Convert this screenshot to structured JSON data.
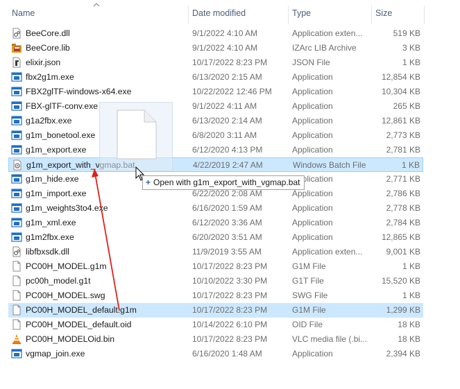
{
  "header": {
    "columns": [
      {
        "label": "Name"
      },
      {
        "label": "Date modified"
      },
      {
        "label": "Type"
      },
      {
        "label": "Size"
      }
    ]
  },
  "files": [
    {
      "name": "BeeCore.dll",
      "date": "9/1/2022 4:10 AM",
      "type": "Application exten...",
      "size": "519 KB",
      "icon": "dll-icon"
    },
    {
      "name": "BeeCore.lib",
      "date": "9/1/2022 4:10 AM",
      "type": "IZArc LIB Archive",
      "size": "3 KB",
      "icon": "lib-archive-icon"
    },
    {
      "name": "elixir.json",
      "date": "10/17/2022 8:23 PM",
      "type": "JSON File",
      "size": "1 KB",
      "icon": "json-file-icon"
    },
    {
      "name": "fbx2g1m.exe",
      "date": "6/13/2020 2:15 AM",
      "type": "Application",
      "size": "12,854 KB",
      "icon": "exe-icon"
    },
    {
      "name": "FBX2glTF-windows-x64.exe",
      "date": "10/22/2022 12:46 PM",
      "type": "Application",
      "size": "10,304 KB",
      "icon": "exe-icon"
    },
    {
      "name": "FBX-glTF-conv.exe",
      "date": "9/1/2022 4:11 AM",
      "type": "Application",
      "size": "265 KB",
      "icon": "exe-icon"
    },
    {
      "name": "g1a2fbx.exe",
      "date": "6/13/2020 2:14 AM",
      "type": "Application",
      "size": "12,861 KB",
      "icon": "exe-icon"
    },
    {
      "name": "g1m_bonetool.exe",
      "date": "6/8/2020 3:11 AM",
      "type": "Application",
      "size": "2,773 KB",
      "icon": "exe-icon"
    },
    {
      "name": "g1m_export.exe",
      "date": "6/12/2020 4:13 PM",
      "type": "Application",
      "size": "2,781 KB",
      "icon": "exe-icon"
    },
    {
      "name": "g1m_export_with_vgmap.bat",
      "date": "4/22/2019 2:47 AM",
      "type": "Windows Batch File",
      "size": "1 KB",
      "icon": "batch-file-icon",
      "state": "drop"
    },
    {
      "name": "g1m_hide.exe",
      "date": "",
      "type": "Application",
      "size": "2,771 KB",
      "icon": "exe-icon"
    },
    {
      "name": "g1m_import.exe",
      "date": "6/22/2020 2:08 AM",
      "type": "Application",
      "size": "2,786 KB",
      "icon": "exe-icon"
    },
    {
      "name": "g1m_weights3to4.exe",
      "date": "6/16/2020 1:59 AM",
      "type": "Application",
      "size": "2,778 KB",
      "icon": "exe-icon"
    },
    {
      "name": "g1m_xml.exe",
      "date": "6/12/2020 3:36 AM",
      "type": "Application",
      "size": "2,784 KB",
      "icon": "exe-icon"
    },
    {
      "name": "g1m2fbx.exe",
      "date": "6/20/2020 3:51 AM",
      "type": "Application",
      "size": "12,865 KB",
      "icon": "exe-icon"
    },
    {
      "name": "libfbxsdk.dll",
      "date": "11/9/2019 3:55 AM",
      "type": "Application exten...",
      "size": "9,001 KB",
      "icon": "dll-icon"
    },
    {
      "name": "PC00H_MODEL.g1m",
      "date": "10/17/2022 8:23 PM",
      "type": "G1M File",
      "size": "1 KB",
      "icon": "blank-file-icon"
    },
    {
      "name": "pc00h_model.g1t",
      "date": "10/10/2022 3:30 PM",
      "type": "G1T File",
      "size": "15,520 KB",
      "icon": "blank-file-icon"
    },
    {
      "name": "PC00H_MODEL.swg",
      "date": "10/17/2022 8:23 PM",
      "type": "SWG File",
      "size": "1 KB",
      "icon": "blank-file-icon"
    },
    {
      "name": "PC00H_MODEL_default.g1m",
      "date": "10/17/2022 8:23 PM",
      "type": "G1M File",
      "size": "1,299 KB",
      "icon": "blank-file-icon",
      "state": "selected"
    },
    {
      "name": "PC00H_MODEL_default.oid",
      "date": "10/14/2022 6:10 PM",
      "type": "OID File",
      "size": "18 KB",
      "icon": "blank-file-icon"
    },
    {
      "name": "PC00H_MODELOid.bin",
      "date": "10/17/2022 8:23 PM",
      "type": "VLC media file (.bi...",
      "size": "18 KB",
      "icon": "vlc-cone-icon"
    },
    {
      "name": "vgmap_join.exe",
      "date": "6/16/2020 1:48 AM",
      "type": "Application",
      "size": "2,394 KB",
      "icon": "exe-icon"
    }
  ],
  "drag": {
    "tooltip_label": "Open with g1m_export_with_vgmap.bat"
  },
  "colors": {
    "selection": "#cce8ff",
    "selection_border": "#99d1ff",
    "drag_arrow": "#e0201c",
    "exe_icon": "#1f6fc5"
  }
}
